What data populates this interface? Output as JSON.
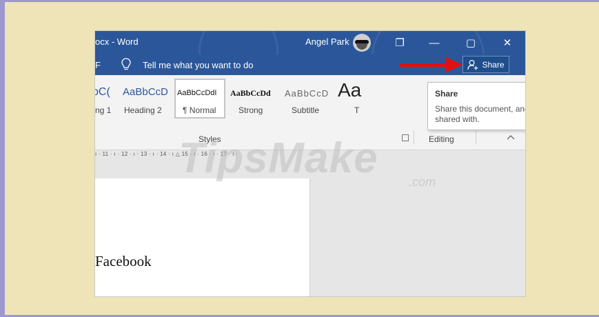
{
  "titlebar": {
    "doc_title": "ocx  -  Word",
    "user_name": "Angel Park",
    "restore_glyph": "❐",
    "minimize_glyph": "—",
    "maximize_glyph": "▢",
    "close_glyph": "✕"
  },
  "tellbar": {
    "tab_fragment": "F",
    "tell_me": "Tell me what you want to do",
    "share_label": "Share"
  },
  "ribbon": {
    "styles": [
      {
        "sample": "bC(",
        "label": "ng 1"
      },
      {
        "sample": "AaBbCcD",
        "label": "Heading 2"
      },
      {
        "sample": "AaBbCcDdI",
        "label": "¶ Normal"
      },
      {
        "sample": "AaBbCcDd",
        "label": "Strong"
      },
      {
        "sample": "AaBbCcD",
        "label": "Subtitle"
      },
      {
        "sample": "Aa",
        "label": "T"
      }
    ],
    "styles_group_label": "Styles",
    "editing_group_label": "Editing"
  },
  "tooltip": {
    "title": "Share",
    "body": "Share this document, and see who it's shared with."
  },
  "ruler": {
    "text": "ı · 11 · ı · 12 · ı · 13 · ı · 14 · ı △ 15 · ı · 16 · ı · 17 · ı ·"
  },
  "document": {
    "visible_text": "Facebook"
  },
  "watermark": {
    "text": "TipsMake",
    "suffix": ".com"
  },
  "colors": {
    "word_blue": "#2b579a",
    "arrow_red": "#e01010",
    "frame_purple": "#9d99cf",
    "background_cream": "#efe4b8"
  }
}
